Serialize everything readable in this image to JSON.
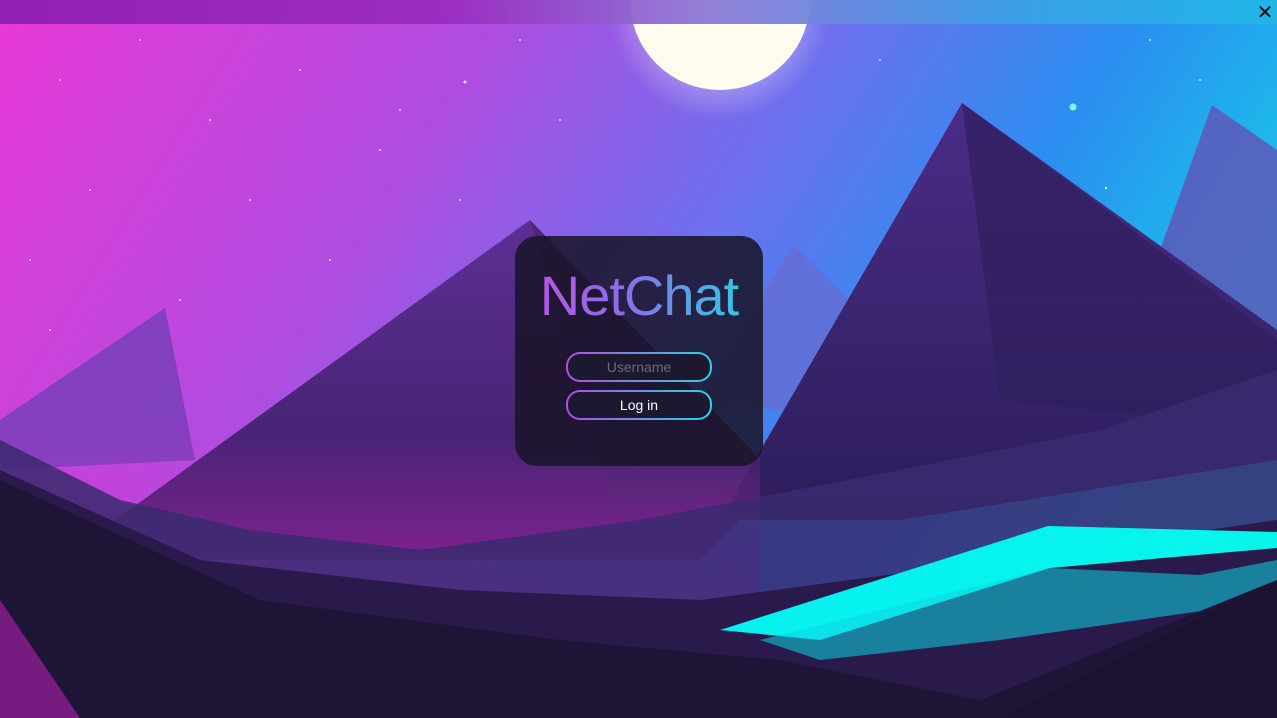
{
  "window": {
    "close_glyph": "✕"
  },
  "login": {
    "app_name": "NetChat",
    "username_placeholder": "Username",
    "username_value": "",
    "login_label": "Log in"
  },
  "colors": {
    "accent_purple": "#b44be0",
    "accent_cyan": "#27d4e8",
    "card_bg": "#18142a"
  }
}
